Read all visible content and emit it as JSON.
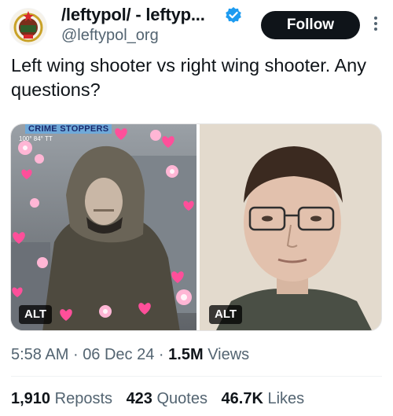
{
  "author": {
    "display_name": "/leftypol/ - leftyp...",
    "handle": "@leftypol_org",
    "follow_label": "Follow",
    "verified_color": "#1d9bf0"
  },
  "tweet": {
    "text": "Left wing shooter vs right wing shooter. Any questions?"
  },
  "media": {
    "left": {
      "alt_label": "ALT",
      "camera_caption": "CRIME STOPPERS",
      "camera_sub": "100° 84° TT"
    },
    "right": {
      "alt_label": "ALT"
    }
  },
  "meta": {
    "time": "5:58 AM",
    "separator": "·",
    "date": "06 Dec 24",
    "views_count": "1.5M",
    "views_label": "Views"
  },
  "stats": {
    "reposts_count": "1,910",
    "reposts_label": "Reposts",
    "quotes_count": "423",
    "quotes_label": "Quotes",
    "likes_count": "46.7K",
    "likes_label": "Likes"
  },
  "colors": {
    "text_primary": "#0f1419",
    "text_secondary": "#536471",
    "heart_pink": "#ff4f9a"
  }
}
